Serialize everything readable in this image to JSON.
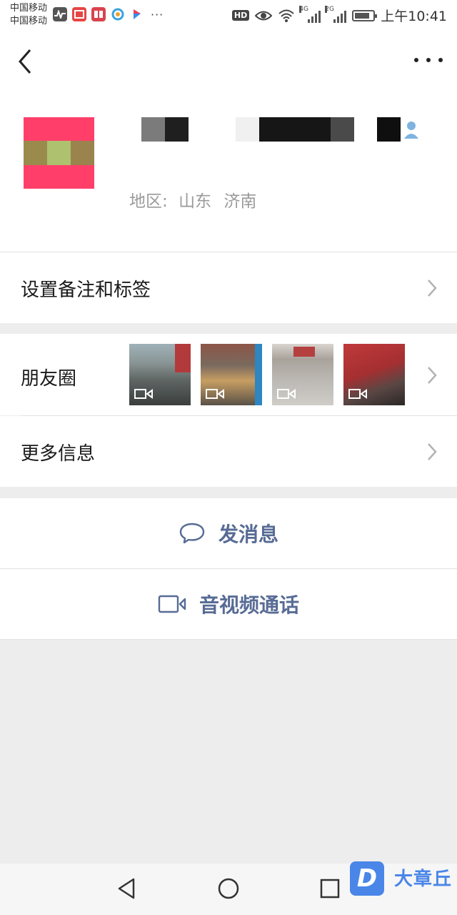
{
  "status_bar": {
    "carrier_1": "中国移动",
    "carrier_2": "中国移动",
    "hd_label": "HD",
    "signal_1_tag": "4G",
    "signal_2_tag": "2G",
    "time": "上午10:41",
    "more_label": "···"
  },
  "header": {
    "back_icon": "chevron-left-icon",
    "more_icon": "more-dots-icon"
  },
  "profile": {
    "region_label": "地区:",
    "region_province": "山东",
    "region_city": "济南"
  },
  "menu": {
    "remark_tags_label": "设置备注和标签",
    "moments_label": "朋友圈",
    "more_info_label": "更多信息"
  },
  "actions": {
    "message_label": "发消息",
    "call_label": "音视频通话"
  },
  "watermark": {
    "logo_letter": "D",
    "text": "大章丘"
  },
  "colors": {
    "link_blue": "#576b95",
    "background_gray": "#ededed",
    "watermark_blue": "#4a86e8"
  }
}
